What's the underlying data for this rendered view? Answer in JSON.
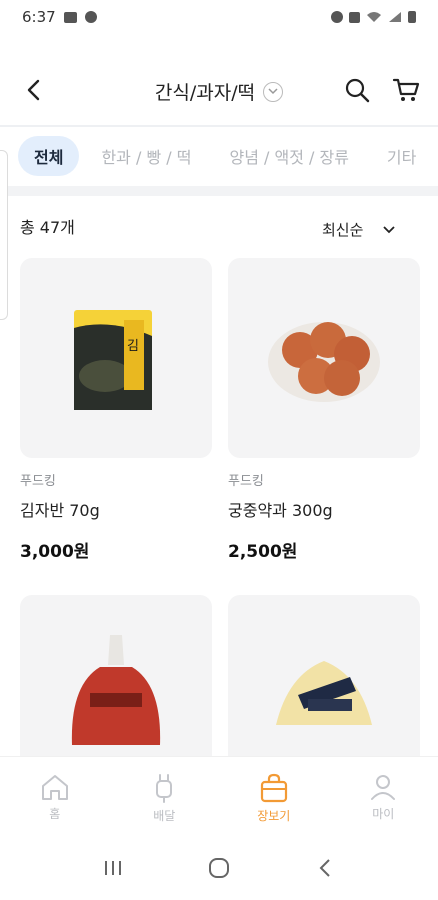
{
  "status_bar": {
    "time": "6:37"
  },
  "header": {
    "title": "간식/과자/떡",
    "back_icon": "chevron-left-icon",
    "search_icon": "search-icon",
    "cart_icon": "cart-icon"
  },
  "tabs": [
    {
      "label": "전체",
      "active": true
    },
    {
      "label": "한과 / 빵 / 떡",
      "active": false
    },
    {
      "label": "양념 / 액젓 / 장류",
      "active": false
    },
    {
      "label": "기타",
      "active": false
    }
  ],
  "list": {
    "count_label": "총 47개",
    "sort_label": "최신순"
  },
  "products": [
    {
      "brand": "푸드킹",
      "name": "김자반 70g",
      "price": "3,000원"
    },
    {
      "brand": "푸드킹",
      "name": "궁중약과 300g",
      "price": "2,500원"
    },
    {
      "brand": "",
      "name": "",
      "price": ""
    },
    {
      "brand": "",
      "name": "",
      "price": ""
    }
  ],
  "bottom_nav": [
    {
      "label": "홈",
      "icon": "home-icon"
    },
    {
      "label": "배달",
      "icon": "delivery-icon"
    },
    {
      "label": "장보기",
      "icon": "shopping-bag-icon",
      "active": true
    },
    {
      "label": "마이",
      "icon": "person-icon"
    }
  ],
  "colors": {
    "accent": "#f29a35",
    "active_tab_bg": "#e3eefc",
    "inactive_text": "#bbbdc2"
  }
}
